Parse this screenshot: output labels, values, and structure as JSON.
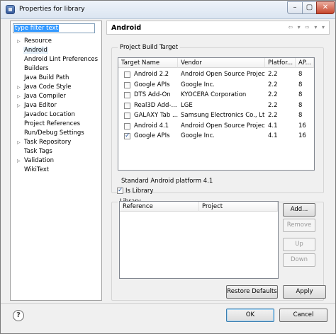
{
  "window": {
    "title": "Properties for library",
    "min": "–",
    "max": "▢",
    "close": "✕"
  },
  "filter": {
    "value": "type filter text"
  },
  "tree": [
    {
      "label": "Resource",
      "expandable": true
    },
    {
      "label": "Android",
      "expandable": false,
      "selected": true
    },
    {
      "label": "Android Lint Preferences",
      "expandable": false
    },
    {
      "label": "Builders",
      "expandable": false
    },
    {
      "label": "Java Build Path",
      "expandable": false
    },
    {
      "label": "Java Code Style",
      "expandable": true
    },
    {
      "label": "Java Compiler",
      "expandable": true
    },
    {
      "label": "Java Editor",
      "expandable": true
    },
    {
      "label": "Javadoc Location",
      "expandable": false
    },
    {
      "label": "Project References",
      "expandable": false
    },
    {
      "label": "Run/Debug Settings",
      "expandable": false
    },
    {
      "label": "Task Repository",
      "expandable": true
    },
    {
      "label": "Task Tags",
      "expandable": false
    },
    {
      "label": "Validation",
      "expandable": true
    },
    {
      "label": "WikiText",
      "expandable": false
    }
  ],
  "header": {
    "title": "Android",
    "nav": "⇦ ▾ ⇨ ▾ ▾"
  },
  "build_target": {
    "group_label": "Project Build Target",
    "columns": [
      "Target Name",
      "Vendor",
      "Platfor...",
      "AP..."
    ],
    "rows": [
      {
        "name": "Android 2.2",
        "vendor": "Android Open Source Project",
        "platform": "2.2",
        "api": "8",
        "checked": false
      },
      {
        "name": "Google APIs",
        "vendor": "Google Inc.",
        "platform": "2.2",
        "api": "8",
        "checked": false
      },
      {
        "name": "DTS Add-On",
        "vendor": "KYOCERA Corporation",
        "platform": "2.2",
        "api": "8",
        "checked": false
      },
      {
        "name": "Real3D Add-...",
        "vendor": "LGE",
        "platform": "2.2",
        "api": "8",
        "checked": false
      },
      {
        "name": "GALAXY Tab ...",
        "vendor": "Samsung Electronics Co., Lt...",
        "platform": "2.2",
        "api": "8",
        "checked": false
      },
      {
        "name": "Android 4.1",
        "vendor": "Android Open Source Project",
        "platform": "4.1",
        "api": "16",
        "checked": false
      },
      {
        "name": "Google APIs",
        "vendor": "Google Inc.",
        "platform": "4.1",
        "api": "16",
        "checked": true
      }
    ],
    "platform_text": "Standard Android platform 4.1"
  },
  "library": {
    "group_label": "Library",
    "is_library_label": "Is Library",
    "is_library_checked": true,
    "columns": [
      "Reference",
      "Project"
    ],
    "buttons": {
      "add": "Add...",
      "remove": "Remove",
      "up": "Up",
      "down": "Down"
    }
  },
  "actions": {
    "restore": "Restore Defaults",
    "apply": "Apply",
    "ok": "OK",
    "cancel": "Cancel",
    "help": "?"
  }
}
